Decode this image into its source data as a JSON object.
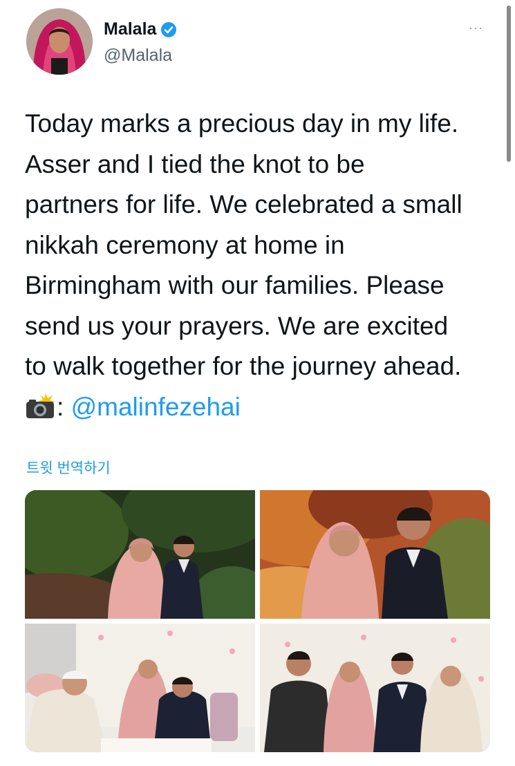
{
  "tweet": {
    "author_name": "Malala",
    "author_handle": "@Malala",
    "verified": true,
    "more_options": "···",
    "text_lines": [
      "Today marks a precious day in my life.",
      "Asser and I tied the knot to be",
      "partners for life. We celebrated a small",
      "nikkah ceremony at home in",
      "Birmingham with our families. Please",
      "send us your prayers. We are excited",
      "to walk together for the journey ahead."
    ],
    "photo_credit_sep": ":",
    "photo_credit_mention": "@malinfezehai",
    "translate_label": "트윗 번역하기",
    "media_count": 4
  },
  "colors": {
    "accent": "#1d9bf0",
    "text": "#0f1419",
    "secondary": "#536471"
  }
}
